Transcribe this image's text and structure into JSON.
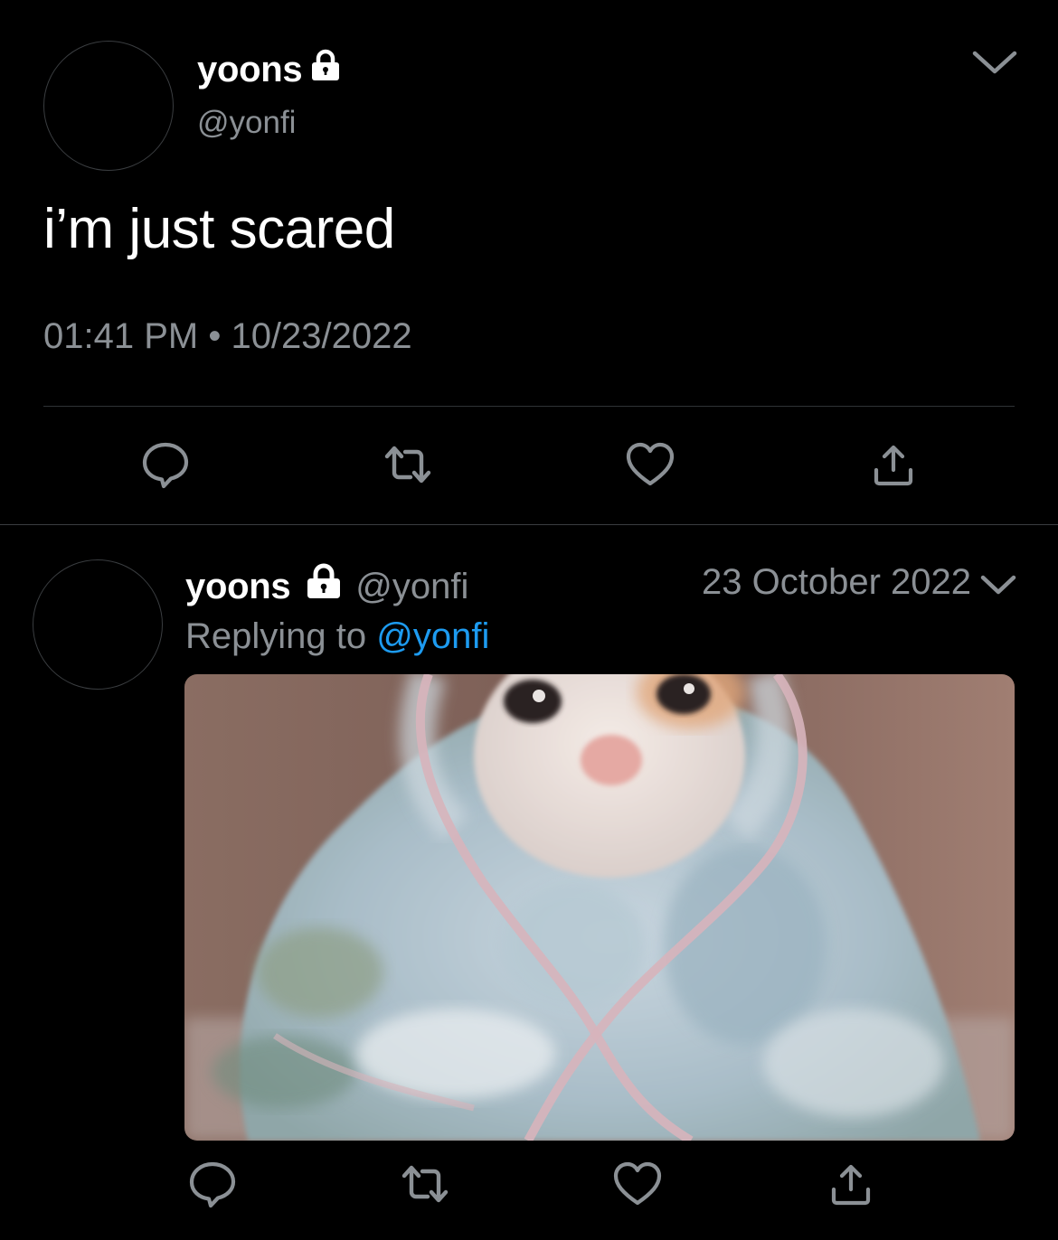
{
  "main_tweet": {
    "display_name": "yoons",
    "handle": "@yonfi",
    "text": "i’m just scared",
    "timestamp": "01:41 PM • 10/23/2022",
    "icons": {
      "lock": "lock-icon",
      "menu": "chevron-down-icon",
      "reply": "reply-icon",
      "retweet": "retweet-icon",
      "like": "heart-icon",
      "share": "share-icon"
    }
  },
  "reply_tweet": {
    "display_name": "yoons",
    "handle": "@yonfi",
    "date": "23 October 2022",
    "replying_label": "Replying to",
    "replying_to": "@yonfi",
    "media": {
      "subject": "crying cat wrapped in a pastel blanket"
    }
  },
  "colors": {
    "background": "#000000",
    "primary_text": "#ffffff",
    "secondary_text": "#8b9095",
    "link": "#1d9bf0",
    "divider": "#2f3336"
  }
}
